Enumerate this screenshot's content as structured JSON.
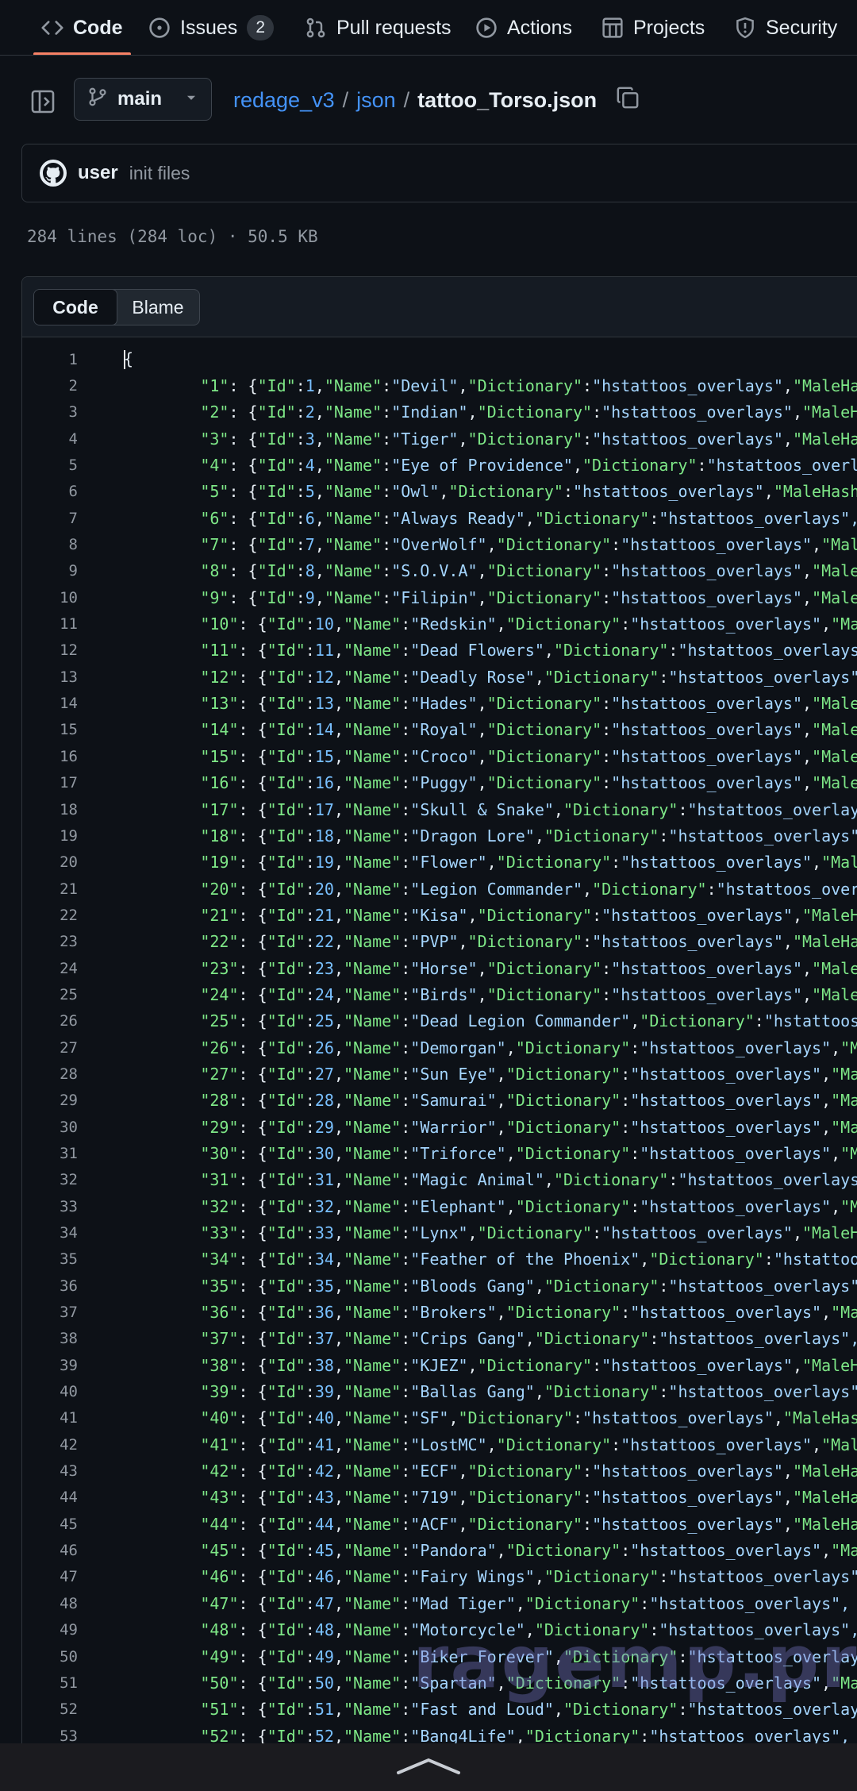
{
  "tabs": [
    {
      "label": "Code",
      "icon": "code-icon",
      "selected": true
    },
    {
      "label": "Issues",
      "icon": "issue-icon",
      "count": "2"
    },
    {
      "label": "Pull requests",
      "icon": "pull-request-icon"
    },
    {
      "label": "Actions",
      "icon": "actions-icon"
    },
    {
      "label": "Projects",
      "icon": "projects-icon"
    },
    {
      "label": "Security",
      "icon": "shield-icon"
    }
  ],
  "branch": {
    "name": "main"
  },
  "breadcrumb": {
    "repo": "redage_v3",
    "sep": "/",
    "folder": "json",
    "file": "tattoo_Torso.json"
  },
  "commit": {
    "user": "user",
    "message": "init files"
  },
  "file_meta": "284 lines (284 loc) · 50.5 KB",
  "code_view": {
    "code_label": "Code",
    "blame_label": "Blame"
  },
  "code": {
    "first_line": "{",
    "dictionary": "hstattoos_overlays",
    "tails": [
      "MaleHa",
      "MaleH",
      "MaleHa",
      "hstattoos_overl",
      "MaleHash",
      "hstattoos_overlays\",",
      "Mal",
      "Male",
      "Male",
      "Ma",
      "hstattoos_overlays",
      "hstattoos_overlays\"",
      "Male",
      "Male",
      "Male",
      "Male",
      "hstattoos_overlay",
      "hstattoos_overlays\"",
      "Mal",
      "hstattoos_over",
      "MaleH",
      "MaleHa",
      "Male",
      "Male",
      "hstattoos",
      "M",
      "Ma",
      "Ma",
      "Ma",
      "M",
      "hstattoos_overlays",
      "M",
      "MaleH",
      "hstattoo",
      "hstattoos_overlays\"",
      "Ma",
      "hstattoos_overlays\",",
      "MaleH",
      "hstattoos_overlays\"",
      "MaleHas",
      "Mal",
      "MaleHa",
      "MaleHa",
      "MaleHa",
      "Ma",
      "hstattoos_overlays\"",
      "hstattoos_overlays\",",
      "hstattoos_overlays\",",
      "hstattoos_overlay",
      "Ma",
      "hstattoos_overlay",
      "hstattoos_overlays\","
    ],
    "names": [
      "Devil",
      "Indian",
      "Tiger",
      "Eye of Providence",
      "Owl",
      "Always Ready",
      "OverWolf",
      "S.O.V.A",
      "Filipin",
      "Redskin",
      "Dead Flowers",
      "Deadly Rose",
      "Hades",
      "Royal",
      "Croco",
      "Puggy",
      "Skull & Snake",
      "Dragon Lore",
      "Flower",
      "Legion Commander",
      "Kisa",
      "PVP",
      "Horse",
      "Birds",
      "Dead Legion Commander",
      "Demorgan",
      "Sun Eye",
      "Samurai",
      "Warrior",
      "Triforce",
      "Magic Animal",
      "Elephant",
      "Lynx",
      "Feather of the Phoenix",
      "Bloods Gang",
      "Brokers",
      "Crips Gang",
      "KJEZ",
      "Ballas Gang",
      "SF",
      "LostMC",
      "ECF",
      "719",
      "ACF",
      "Pandora",
      "Fairy Wings",
      "Mad Tiger",
      "Motorcycle",
      "Biker Forever",
      "Spartan",
      "Fast and Loud",
      "Bang4Life"
    ]
  },
  "watermark": "ragemp.pro",
  "colors": {
    "background": "#0d1117",
    "accent": "#f78166",
    "link": "#4493f8",
    "key": "#7ee787",
    "string": "#a5d6ff",
    "number": "#79c0ff"
  }
}
